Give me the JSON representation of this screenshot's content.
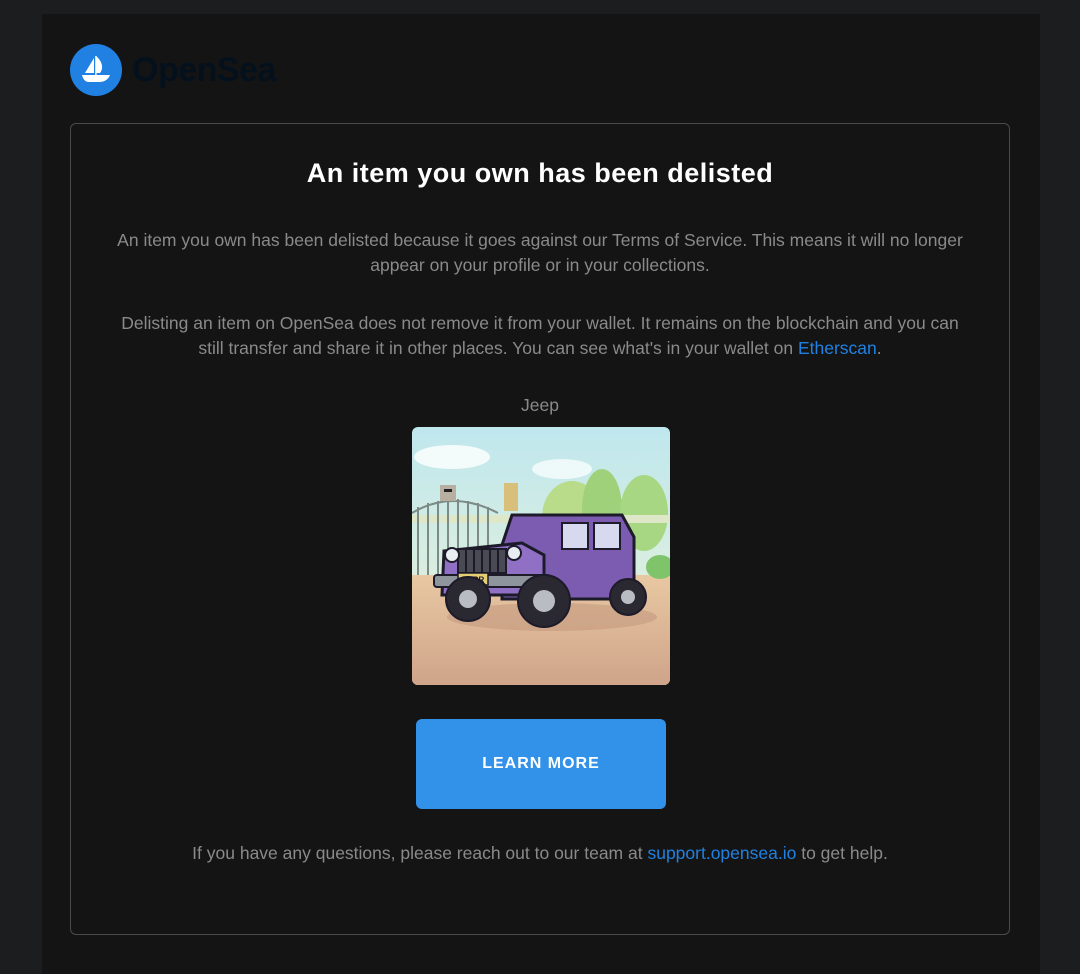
{
  "brand": {
    "name": "OpenSea",
    "logo_icon": "opensea-boat-icon",
    "colors": {
      "logo": "#2081e2",
      "wordmark": "#04111d"
    }
  },
  "notice": {
    "title": "An item you own has been delisted",
    "paragraph1": "An item you own has been delisted because it goes against our Terms of Service. This means it will no longer appear on your profile or in your collections.",
    "paragraph2_text": "Delisting an item on OpenSea does not remove it from your wallet. It remains on the blockchain and you can still transfer and share it in other places. You can see what's in your wallet on ",
    "paragraph2_link": "Etherscan",
    "paragraph2_end": "."
  },
  "item": {
    "name": "Jeep",
    "plate_text": "PURR",
    "image_icon": "jeep-nft-image"
  },
  "cta": {
    "label": "LEARN MORE",
    "color": "#3291e9"
  },
  "footer": {
    "text_before": "If you have any questions, please reach out to our team at ",
    "link": "support.opensea.io",
    "text_after": " to get help."
  },
  "colors": {
    "page_bg": "#1b1d1f",
    "email_bg": "#141414",
    "text_muted": "#8a8a8a",
    "link": "#2081e2"
  }
}
